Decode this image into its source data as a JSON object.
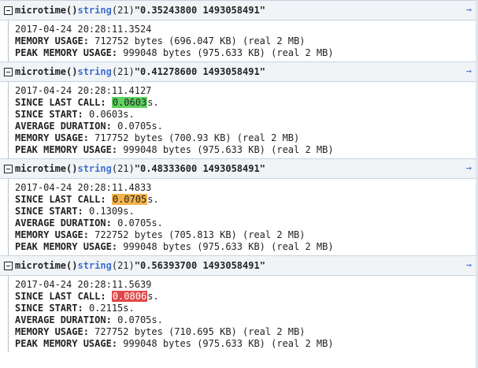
{
  "blocks": [
    {
      "fn": "microtime()",
      "type": "string",
      "len": "(21)",
      "value": "\"0.35243800 1493058491\"",
      "arrow": "→",
      "date": "2017-04-24 20:28:11.3524",
      "memory_label": "MEMORY USAGE:",
      "memory": "712752 bytes (696.047 KB) (real 2 MB)",
      "peak_label": "PEAK MEMORY USAGE:",
      "peak": "999048 bytes (975.633 KB) (real 2 MB)"
    },
    {
      "fn": "microtime()",
      "type": "string",
      "len": "(21)",
      "value": "\"0.41278600 1493058491\"",
      "arrow": "→",
      "date": "2017-04-24 20:28:11.4127",
      "since_last_label": "SINCE LAST CALL:",
      "since_last": "0.0603",
      "since_last_suffix": "s.",
      "since_last_color": "#5fd35f",
      "since_start_label": "SINCE START:",
      "since_start": "0.0603s.",
      "avg_label": "AVERAGE DURATION:",
      "avg": "0.0705s.",
      "memory_label": "MEMORY USAGE:",
      "memory": "717752 bytes (700.93 KB) (real 2 MB)",
      "peak_label": "PEAK MEMORY USAGE:",
      "peak": "999048 bytes (975.633 KB) (real 2 MB)"
    },
    {
      "fn": "microtime()",
      "type": "string",
      "len": "(21)",
      "value": "\"0.48333600 1493058491\"",
      "arrow": "→",
      "date": "2017-04-24 20:28:11.4833",
      "since_last_label": "SINCE LAST CALL:",
      "since_last": "0.0705",
      "since_last_suffix": "s.",
      "since_last_color": "#f3b24a",
      "since_start_label": "SINCE START:",
      "since_start": "0.1309s.",
      "avg_label": "AVERAGE DURATION:",
      "avg": "0.0705s.",
      "memory_label": "MEMORY USAGE:",
      "memory": "722752 bytes (705.813 KB) (real 2 MB)",
      "peak_label": "PEAK MEMORY USAGE:",
      "peak": "999048 bytes (975.633 KB) (real 2 MB)"
    },
    {
      "fn": "microtime()",
      "type": "string",
      "len": "(21)",
      "value": "\"0.56393700 1493058491\"",
      "arrow": "→",
      "date": "2017-04-24 20:28:11.5639",
      "since_last_label": "SINCE LAST CALL:",
      "since_last": "0.0806",
      "since_last_suffix": "s.",
      "since_last_color": "#e04848",
      "since_start_label": "SINCE START:",
      "since_start": "0.2115s.",
      "avg_label": "AVERAGE DURATION:",
      "avg": "0.0705s.",
      "memory_label": "MEMORY USAGE:",
      "memory": "727752 bytes (710.695 KB) (real 2 MB)",
      "peak_label": "PEAK MEMORY USAGE:",
      "peak": "999048 bytes (975.633 KB) (real 2 MB)"
    }
  ]
}
